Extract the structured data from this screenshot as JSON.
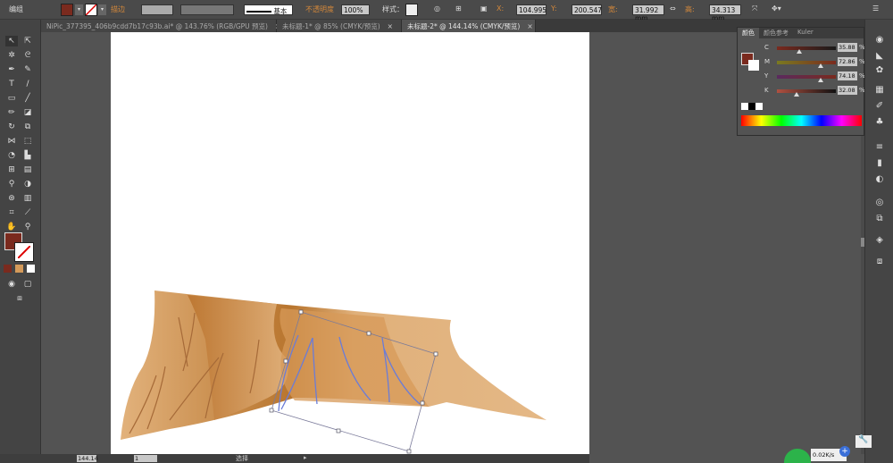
{
  "control_bar": {
    "mode_label": "编组",
    "stroke_label": "描边",
    "stroke_profile": "基本",
    "opacity_label": "不透明度",
    "opacity_value": "100%",
    "style_label": "样式：",
    "x_value": "104.995",
    "y_value": "200.547",
    "w_value": "31.992 mm",
    "h_value": "34.313 mm",
    "fill_color": "#7a2a1e"
  },
  "tabs": [
    {
      "label": "NiPic_377395_406b9cdd7b17c93b.ai* @ 143.76% (RGB/GPU 预览)",
      "close": "×"
    },
    {
      "label": "未标题-1* @ 85% (CMYK/预览)",
      "close": "×"
    },
    {
      "label": "未标题-2* @ 144.14% (CMYK/预览)",
      "close": "×",
      "active": true
    }
  ],
  "color_panel": {
    "tabs": [
      "颜色",
      "颜色参考",
      "Kuler"
    ],
    "channels": [
      {
        "name": "C",
        "value": "35.88",
        "percent": 35.88,
        "unit": "%"
      },
      {
        "name": "M",
        "value": "72.86",
        "percent": 72.86,
        "unit": "%"
      },
      {
        "name": "Y",
        "value": "74.18",
        "percent": 74.18,
        "unit": "%"
      },
      {
        "name": "K",
        "value": "32.08",
        "percent": 32.08,
        "unit": "%"
      }
    ],
    "fill_color": "#7a2a1e"
  },
  "status_bar": {
    "zoom": "144.14",
    "page": "1",
    "tool_name": "选择"
  },
  "tray": {
    "net_speed": "0.02K/s"
  }
}
